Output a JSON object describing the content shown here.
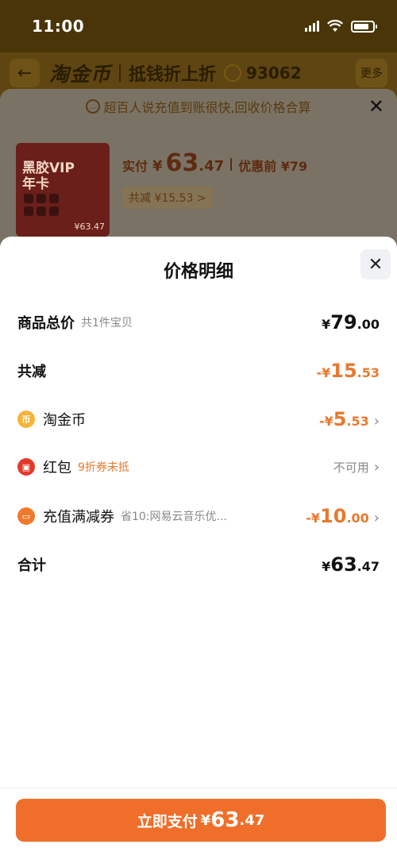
{
  "status_bar": {
    "time": "11:00"
  },
  "header": {
    "brand": "淘金币",
    "slogan": "抵钱折上折",
    "coin_count": "93062",
    "more_label": "更多"
  },
  "product_sheet": {
    "notice": "超百人说充值到账很快,回收价格合算",
    "product_image": {
      "title": "黑胶VIP\n年卡",
      "price_tag": "¥63.47"
    },
    "paid_label": "实付",
    "paid_yen": "¥",
    "paid_int": "63",
    "paid_dec": ".47",
    "before_price": "优惠前 ¥79",
    "reduce_chip": "共减 ¥15.53 >"
  },
  "detail": {
    "title": "价格明细",
    "rows": {
      "total": {
        "label": "商品总价",
        "sub": "共1件宝贝",
        "yen": "¥",
        "int": "79",
        "dec": ".00"
      },
      "reduced": {
        "label": "共减",
        "yen": "-¥",
        "int": "15",
        "dec": ".53"
      },
      "coin": {
        "label": "淘金币",
        "yen": "-¥",
        "int": "5",
        "dec": ".53"
      },
      "redpacket": {
        "label": "红包",
        "sub": "9折券未抵",
        "status": "不可用"
      },
      "voucher": {
        "label": "充值满减券",
        "sub": "省10:网易云音乐优...",
        "yen": "-¥",
        "int": "10",
        "dec": ".00"
      },
      "sum": {
        "label": "合计",
        "yen": "¥",
        "int": "63",
        "dec": ".47"
      }
    },
    "icons": {
      "coin": "coin-icon",
      "redpacket": "red-packet-icon",
      "voucher": "voucher-icon"
    },
    "colors": {
      "accent": "#ef6f2a",
      "discount": "#e8792e"
    }
  },
  "pay_button": {
    "label": "立即支付",
    "yen": "¥",
    "int": "63",
    "dec": ".47"
  }
}
